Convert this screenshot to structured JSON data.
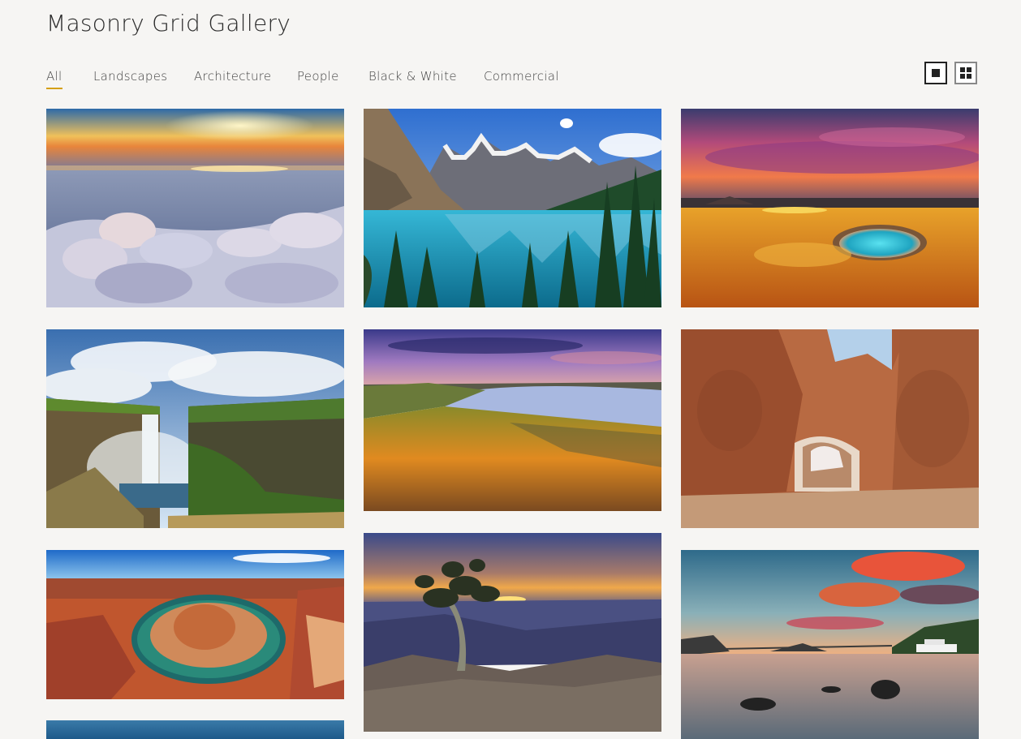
{
  "page": {
    "title": "Masonry Grid Gallery"
  },
  "filters": [
    {
      "label": "All",
      "active": true
    },
    {
      "label": "Landscapes",
      "active": false
    },
    {
      "label": "Architecture",
      "active": false
    },
    {
      "label": "People",
      "active": false
    },
    {
      "label": "Black & White",
      "active": false
    },
    {
      "label": "Commercial",
      "active": false
    }
  ],
  "view_toggle": {
    "options": [
      "single-view-icon",
      "grid-view-icon"
    ],
    "selected": "single-view-icon"
  },
  "colors": {
    "accent": "#d4a015",
    "background": "#f6f5f3"
  },
  "gallery": [
    {
      "name": "photo-frozen-lake-sunset"
    },
    {
      "name": "photo-mountain-lake"
    },
    {
      "name": "photo-volcanic-pool-sunset"
    },
    {
      "name": "photo-waterfall-gorge"
    },
    {
      "name": "photo-lake-golden-grass"
    },
    {
      "name": "photo-rock-arch-canyon"
    },
    {
      "name": "photo-horseshoe-bend"
    },
    {
      "name": "photo-lone-tree-canyon-sunset"
    },
    {
      "name": "photo-calm-lake-sunset-boat"
    },
    {
      "name": "photo-partial-bottom"
    }
  ]
}
